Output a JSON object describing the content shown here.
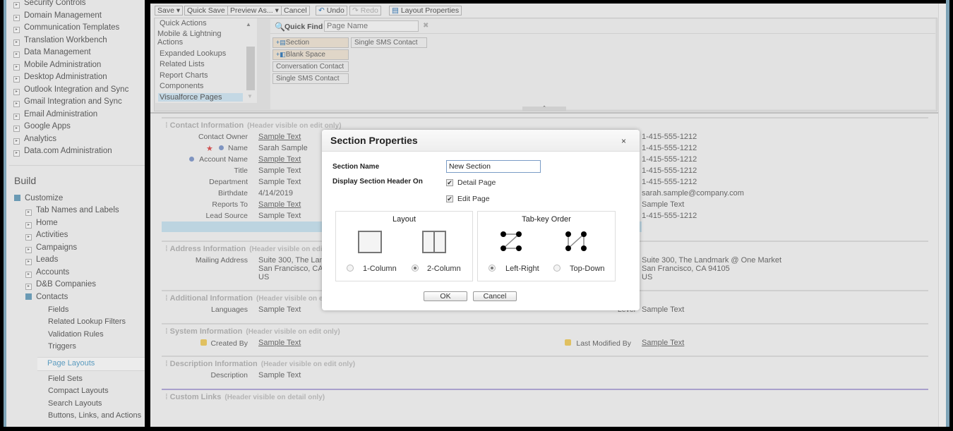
{
  "sidebar": {
    "admin_items": [
      "Security Controls",
      "Domain Management",
      "Communication Templates",
      "Translation Workbench",
      "Data Management",
      "Mobile Administration",
      "Desktop Administration",
      "Outlook Integration and Sync",
      "Gmail Integration and Sync",
      "Email Administration",
      "Google Apps",
      "Analytics",
      "Data.com Administration"
    ],
    "build_heading": "Build",
    "customize": "Customize",
    "customize_items": [
      "Tab Names and Labels",
      "Home",
      "Activities",
      "Campaigns",
      "Leads",
      "Accounts",
      "D&B Companies"
    ],
    "contacts": "Contacts",
    "contacts_items": [
      "Fields",
      "Related Lookup Filters",
      "Validation Rules",
      "Triggers",
      "Page Layouts",
      "Field Sets",
      "Compact Layouts",
      "Search Layouts",
      "Buttons, Links, and Actions"
    ],
    "selected": "Page Layouts",
    "accent": "#5b9bbf"
  },
  "toolbar": {
    "save": "Save",
    "quick_save": "Quick Save",
    "preview_as": "Preview As...",
    "cancel": "Cancel",
    "undo": "Undo",
    "redo": "Redo",
    "layout_properties": "Layout Properties"
  },
  "palette": {
    "categories": [
      "Quick Actions",
      "Mobile & Lightning Actions",
      "Expanded Lookups",
      "Related Lists",
      "Report Charts",
      "Components",
      "Visualforce Pages"
    ],
    "selected": "Visualforce Pages",
    "quick_find_label": "Quick Find",
    "quick_find_placeholder": "Page Name",
    "items": [
      "Section",
      "Blank Space",
      "Conversation Contact",
      "Single SMS Contact",
      "Single SMS Contact"
    ]
  },
  "layout": {
    "contact": {
      "title": "Contact Information",
      "note": "(Header visible on edit only)",
      "left": [
        [
          "Contact Owner",
          "Sample Text",
          true
        ],
        [
          "Name",
          "Sarah Sample",
          false
        ],
        [
          "Account Name",
          "Sample Text",
          true
        ],
        [
          "Title",
          "Sample Text",
          false
        ],
        [
          "Department",
          "Sample Text",
          false
        ],
        [
          "Birthdate",
          "4/14/2019",
          false
        ],
        [
          "Reports To",
          "Sample Text",
          true
        ],
        [
          "Lead Source",
          "Sample Text",
          false
        ]
      ],
      "right": [
        "1-415-555-1212",
        "1-415-555-1212",
        "1-415-555-1212",
        "1-415-555-1212",
        "1-415-555-1212",
        "sarah.sample@company.com",
        "Sample Text",
        "1-415-555-1212"
      ]
    },
    "address": {
      "title": "Address Information",
      "note": "(Header visible on edit only)",
      "label": "Mailing Address",
      "left": [
        "Suite 300, The Landmark @ One Market",
        "San Francisco, CA 94105",
        "US"
      ],
      "right": [
        "Suite 300, The Landmark @ One Market",
        "San Francisco, CA 94105",
        "US"
      ]
    },
    "additional": {
      "title": "Additional Information",
      "note": "(Header visible on edit only)",
      "label": "Languages",
      "value": "Sample Text",
      "right_label": "Level",
      "right_value": "Sample Text"
    },
    "system": {
      "title": "System Information",
      "note": "(Header visible on edit only)",
      "label": "Created By",
      "value": "Sample Text",
      "right_label": "Last Modified By",
      "right_value": "Sample Text"
    },
    "description": {
      "title": "Description Information",
      "note": "(Header visible on edit only)",
      "label": "Description",
      "value": "Sample Text"
    },
    "custom_links": {
      "title": "Custom Links",
      "note": "(Header visible on detail only)"
    }
  },
  "dialog": {
    "title": "Section Properties",
    "section_name_label": "Section Name",
    "section_name_value": "New Section",
    "display_header_label": "Display Section Header On",
    "detail_page": "Detail Page",
    "detail_checked": true,
    "edit_page": "Edit Page",
    "edit_checked": true,
    "layout_title": "Layout",
    "one_col": "1-Column",
    "two_col": "2-Column",
    "layout_selected": "2-Column",
    "tab_title": "Tab-key Order",
    "left_right": "Left-Right",
    "top_down": "Top-Down",
    "tab_selected": "Left-Right",
    "ok": "OK",
    "cancel": "Cancel"
  }
}
